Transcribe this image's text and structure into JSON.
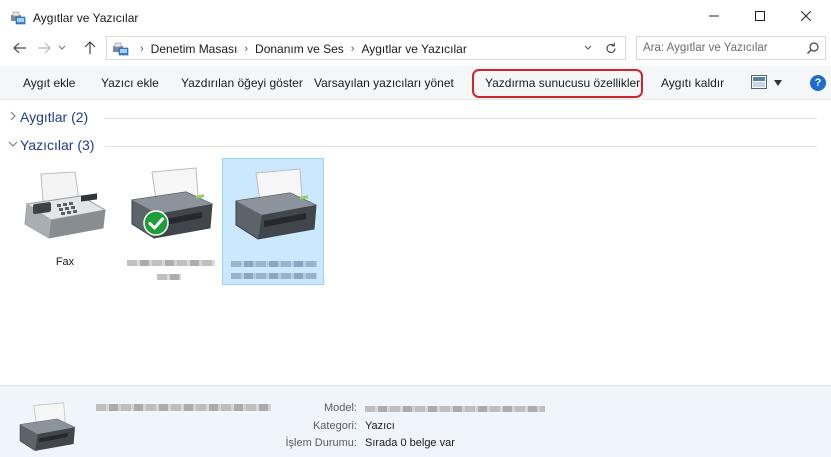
{
  "window": {
    "title": "Aygıtlar ve Yazıcılar",
    "buttons": {
      "minimize": "—",
      "maximize": "☐",
      "close": "✕"
    }
  },
  "address": {
    "breadcrumbs": [
      "Denetim Masası",
      "Donanım ve Ses",
      "Aygıtlar ve Yazıcılar"
    ],
    "separator": "›",
    "search_placeholder": "Ara: Aygıtlar ve Yazıcılar"
  },
  "toolbar": {
    "add_device": "Aygıt ekle",
    "add_printer": "Yazıcı ekle",
    "see_whats_printing": "Yazdırılan öğeyi göster",
    "manage_default": "Varsayılan yazıcıları yönet",
    "print_server_props": "Yazdırma sunucusu özellikleri",
    "remove_device": "Aygıtı kaldır",
    "help": "?",
    "highlight_color": "#d1262a"
  },
  "groups": {
    "devices": {
      "label": "Aygıtlar (2)",
      "collapsed": true
    },
    "printers": {
      "label": "Yazıcılar (3)",
      "collapsed": false
    }
  },
  "printers": [
    {
      "label": "Fax",
      "icon": "fax-icon",
      "default": false,
      "selected": false
    },
    {
      "label": "",
      "icon": "printer-icon",
      "default": true,
      "selected": false,
      "name_redacted": true
    },
    {
      "label": "",
      "icon": "printer-icon",
      "default": false,
      "selected": true,
      "name_redacted": true
    }
  ],
  "details": {
    "model_label": "Model:",
    "category_label": "Kategori:",
    "category_value": "Yazıcı",
    "status_label": "İşlem Durumu:",
    "status_value": "Sırada 0 belge var"
  },
  "colors": {
    "group_header": "#1e3b8f",
    "selection_bg": "#cce8ff",
    "selection_border": "#99d1ff",
    "default_check": "#1e9e3a",
    "help_badge": "#1f6ccf"
  }
}
